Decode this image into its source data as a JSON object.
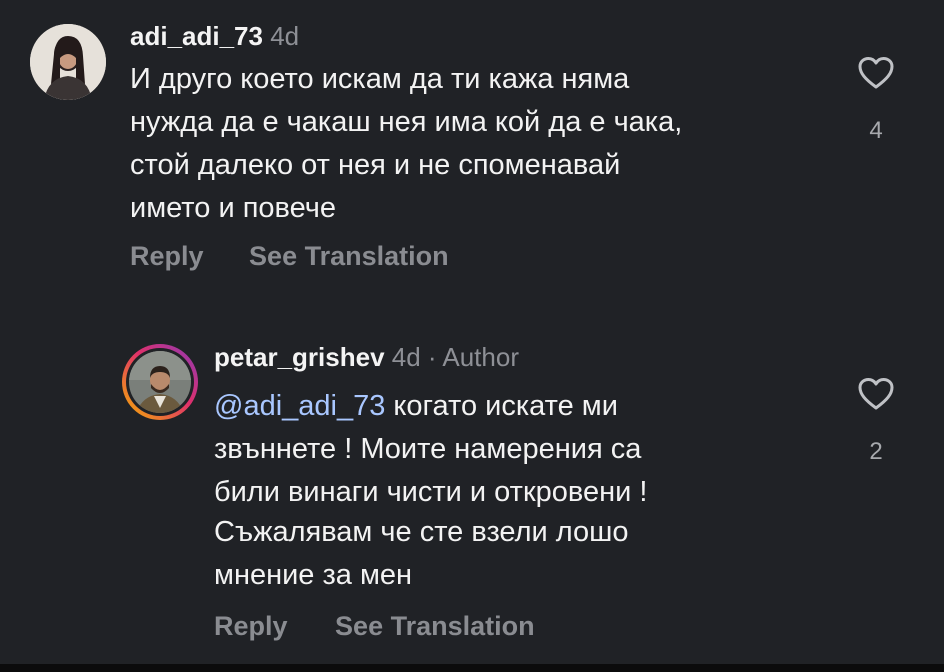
{
  "comments": [
    {
      "username": "adi_adi_73",
      "time": "4d",
      "author_tag": "",
      "text": "И друго което искам да ти кажа няма\nнужда да е чакаш нея има кой да е чака,\nстой далеко от нея и не споменавай\nимето и повече",
      "reply_label": "Reply",
      "translate_label": "See Translation",
      "likes": "4"
    },
    {
      "username": "petar_grishev",
      "time": "4d",
      "author_tag": "· Author",
      "mention": "@adi_adi_73",
      "text": " когато искате ми\nзвъннете ! Моите намерения са\nбили винаги чисти и откровени !",
      "text2": "Съжалявам че сте взели лошо\nмнение за мен",
      "reply_label": "Reply",
      "translate_label": "See Translation",
      "likes": "2"
    }
  ],
  "colors": {
    "background": "#202226",
    "mention": "#a9c7ff",
    "muted": "#8e9096",
    "story_ring": [
      "#f5b300",
      "#e0306b",
      "#8a3ab9"
    ]
  },
  "icons": {
    "like": "heart-outline-icon"
  }
}
